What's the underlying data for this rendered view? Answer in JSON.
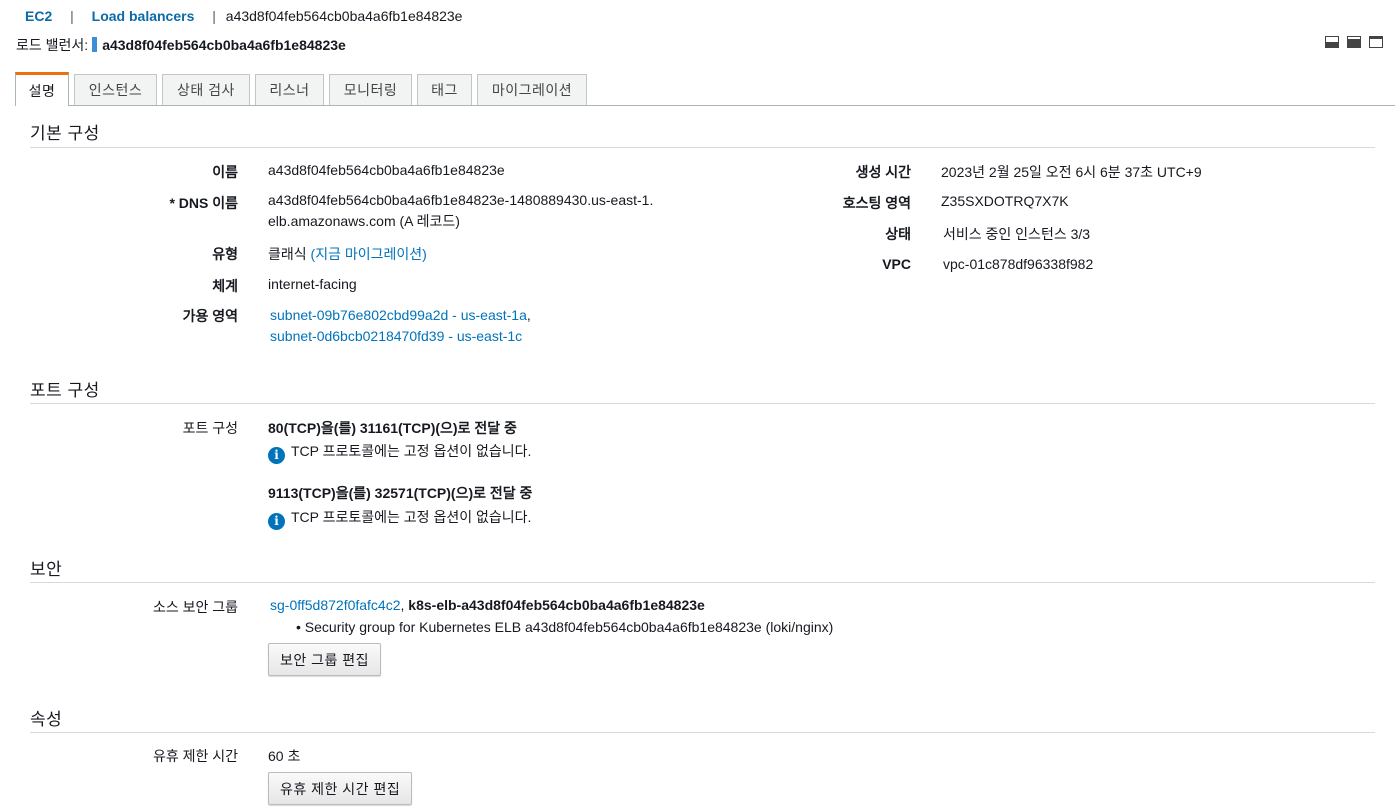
{
  "breadcrumb": {
    "root": "EC2",
    "sep": "|",
    "section": "Load balancers",
    "current": "a43d8f04feb564cb0ba4a6fb1e84823e"
  },
  "header": {
    "label": "로드 밸런서:",
    "name": "a43d8f04feb564cb0ba4a6fb1e84823e"
  },
  "tabs": [
    "설명",
    "인스턴스",
    "상태 검사",
    "리스너",
    "모니터링",
    "태그",
    "마이그레이션"
  ],
  "basic": {
    "title": "기본 구성",
    "name_label": "이름",
    "name_value": "a43d8f04feb564cb0ba4a6fb1e84823e",
    "dns_label": "* DNS 이름",
    "dns_value": "a43d8f04feb564cb0ba4a6fb1e84823e-1480889430.us-east-1.elb.amazonaws.com (A 레코드)",
    "type_label": "유형",
    "type_value": "클래식",
    "type_link": "(지금 마이그레이션)",
    "scheme_label": "체계",
    "scheme_value": "internet-facing",
    "az_label": "가용 영역",
    "az_1": "subnet-09b76e802cbd99a2d - us-east-1a",
    "az_comma": ",",
    "az_2": "subnet-0d6bcb0218470fd39 - us-east-1c",
    "created_label": "생성 시간",
    "created_value": "2023년 2월 25일 오전 6시 6분 37초 UTC+9",
    "zone_label": "호스팅 영역",
    "zone_value": "Z35SXDOTRQ7X7K",
    "status_label": "상태",
    "status_value": "서비스 중인 인스턴스 3/3",
    "vpc_label": "VPC",
    "vpc_value": "vpc-01c878df96338f982"
  },
  "ports": {
    "title": "포트 구성",
    "label": "포트 구성",
    "rule1": "80(TCP)을(를) 31161(TCP)(으)로 전달 중",
    "note1": "TCP 프로토콜에는 고정 옵션이 없습니다.",
    "rule2": "9113(TCP)을(를) 32571(TCP)(으)로 전달 중",
    "note2": "TCP 프로토콜에는 고정 옵션이 없습니다."
  },
  "security": {
    "title": "보안",
    "label": "소스 보안 그룹",
    "sg_id": "sg-0ff5d872f0fafc4c2",
    "sg_comma": ",",
    "sg_name": "k8s-elb-a43d8f04feb564cb0ba4a6fb1e84823e",
    "sg_desc": "• Security group for Kubernetes ELB a43d8f04feb564cb0ba4a6fb1e84823e (loki/nginx)",
    "edit_button": "보안 그룹 편집"
  },
  "attributes": {
    "title": "속성",
    "idle_label": "유휴 제한 시간",
    "idle_value": "60 초",
    "edit_button": "유휴 제한 시간 편집"
  },
  "icons": {
    "info": "info-icon",
    "layout": [
      "layout-bottom-icon",
      "layout-split-icon",
      "layout-full-icon"
    ]
  },
  "colors": {
    "link": "#0073bb",
    "active_tab": "#ec7211",
    "info": "#0073bb"
  }
}
